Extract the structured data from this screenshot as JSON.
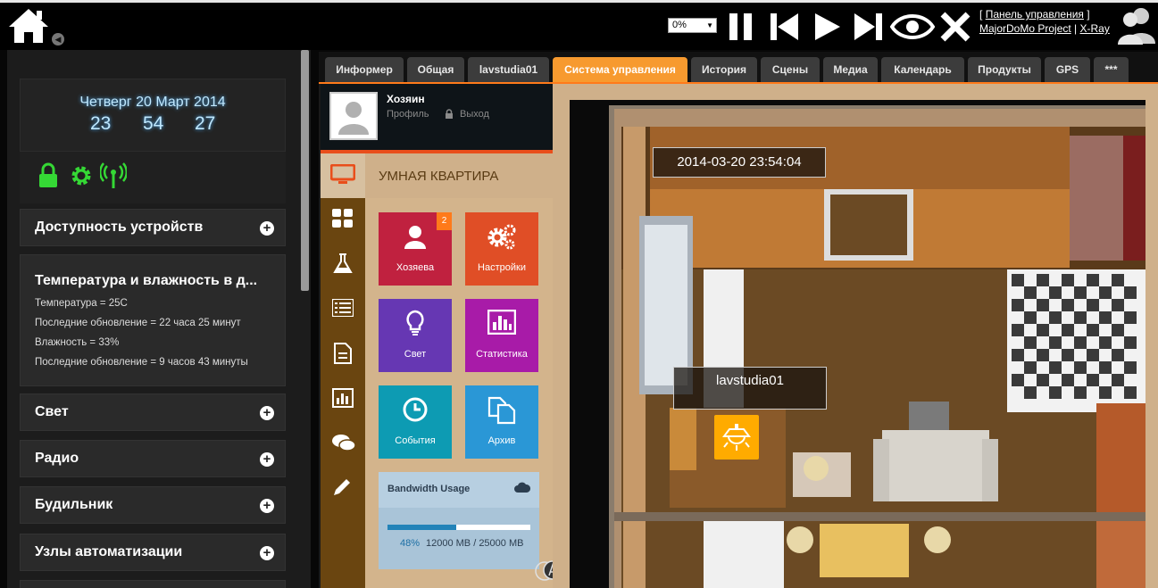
{
  "topbar": {
    "volume": "0%",
    "links": {
      "panel": "Панель управления",
      "project": "MajorDoMo Project",
      "xray": "X-Ray",
      "open_bracket": "[",
      "close_bracket": "]",
      "separator": "|"
    },
    "controls": [
      "pause-icon",
      "previous-icon",
      "play-icon",
      "next-icon",
      "eye-icon",
      "close-icon"
    ]
  },
  "sidebar": {
    "date": "Четверг 20 Март 2014",
    "hours": "23",
    "minutes": "54",
    "seconds": "27",
    "status_icons": [
      "lock-icon",
      "gear-icon",
      "antenna-icon"
    ],
    "status_color": "#35d835",
    "panels": {
      "devices": "Доступность устройств",
      "temp_title": "Температура и влажность в д...",
      "temp_lines": [
        "Температура = 25С",
        "Последние обновление = 22 часа 25 минут",
        "Влажность = 33%",
        "Последние обновление = 9 часов 43 минуты"
      ],
      "light": "Свет",
      "radio": "Радио",
      "alarm": "Будильник",
      "nodes": "Узлы автоматизации"
    }
  },
  "tabs": [
    "Информер",
    "Общая",
    "lavstudia01",
    "Система управления",
    "История",
    "Сцены",
    "Медиа",
    "Календарь",
    "Продукты",
    "GPS",
    "***"
  ],
  "active_tab": "Система управления",
  "accent_color": "#f79a2f",
  "smart": {
    "owner": "Хозяин",
    "profile": "Профиль",
    "logout": "Выход",
    "title": "УМНАЯ КВАРТИРА",
    "side_icons": [
      "monitor-icon",
      "grid-icon",
      "flask-icon",
      "list-icon",
      "document-icon",
      "chart-icon",
      "chat-icon",
      "pencil-icon"
    ],
    "tiles": {
      "owners": "Хозяева",
      "owners_badge": "2",
      "settings": "Настройки",
      "light": "Свет",
      "stats": "Статистика",
      "events": "События",
      "archive": "Архив"
    },
    "bandwidth": {
      "title": "Bandwidth Usage",
      "percent": "48%",
      "value": "12000 MB / 25000 MB",
      "fraction": 0.48
    }
  },
  "room": {
    "datetime": "2014-03-20 23:54:04",
    "device": "lavstudia01"
  }
}
